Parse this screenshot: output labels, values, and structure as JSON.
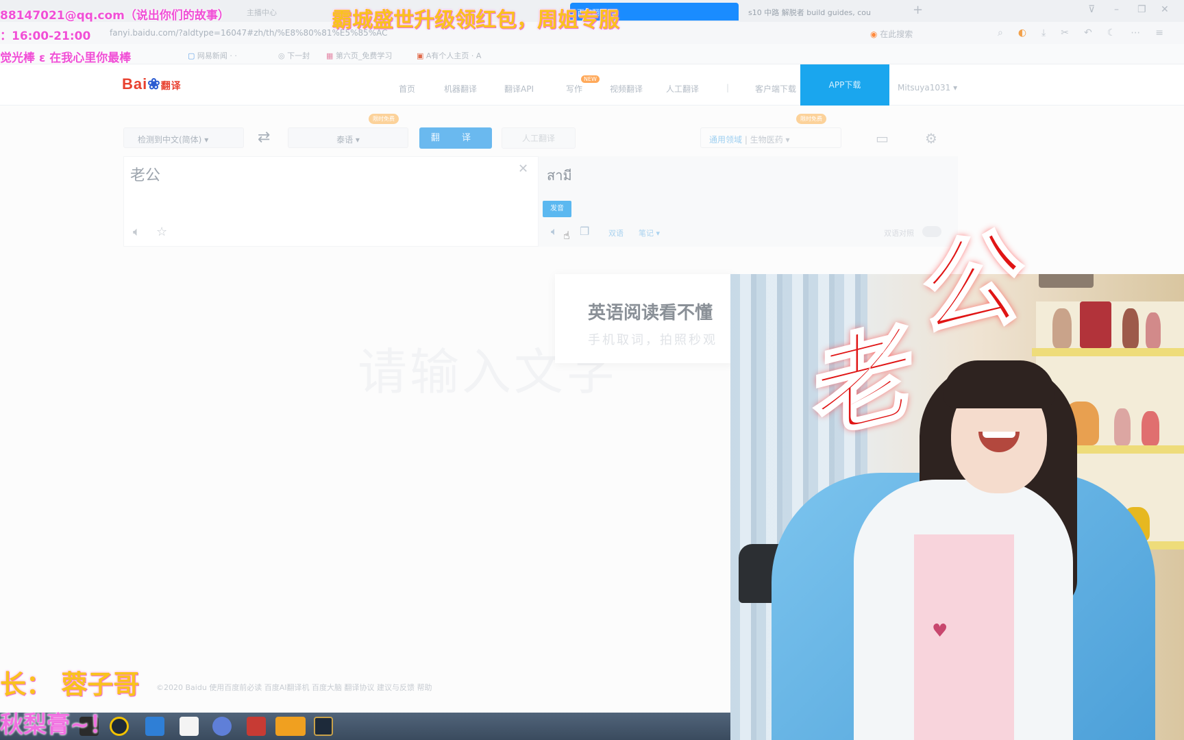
{
  "browser": {
    "tabs": [
      {
        "label": "主播中心",
        "active": false
      },
      {
        "label": "百度翻译",
        "active": true
      },
      {
        "label": "s10 中路 解脱者 build guides, cou",
        "active": false
      }
    ],
    "url": "fanyi.baidu.com/?aldtype=16047#zh/th/%E8%80%81%E5%85%AC",
    "address_search": "在此搜索",
    "bookmarks": [
      "网易新闻 · ·",
      "下一封",
      "第六页_免费学习",
      "A有个人主页 · A"
    ]
  },
  "site": {
    "logo": "Bai",
    "logo_sub": "翻译",
    "nav": [
      "首页",
      "机器翻译",
      "翻译API",
      "写作",
      "视频翻译",
      "人工翻译",
      "客户端下载"
    ],
    "nav_hot": "NEW",
    "app_button": "APP下载",
    "user": "Mitsuya1031"
  },
  "translator": {
    "source_lang": "检测到中文(简体)",
    "target_lang": "泰语",
    "translate_button": "翻  译",
    "human_button": "人工翻译",
    "promo_tag_left": "限时免费",
    "promo_tag_right": "限时免费",
    "domain_label": "通用领域",
    "domain_value": "生物医药",
    "source_text": "老公",
    "target_text": "สามี",
    "tooltip": "发音",
    "link_1": "双语",
    "link_2": "笔记",
    "toggle_label": "双语对照",
    "placeholder": "请输入文字",
    "promo_title": "英语阅读看不懂",
    "promo_sub": "手机取词，拍照秒观",
    "footer": "©2020 Baidu  使用百度前必读  百度AI翻译机  百度大脑  翻译协议  建议与反馈  帮助"
  },
  "overlays": {
    "email": "88147021@qq.com（说出你们的故事）",
    "time": "：16:00-21:00",
    "banner": "霸城盛世升级领红包，周姐专服",
    "line_left": "觉光棒 ε 在我心里你最棒",
    "bottom_label": "长：  蓉子哥",
    "bottom_line": "秋梨膏~！",
    "sticker": "老公"
  },
  "colors": {
    "app_button_bg": "#1aa6ee",
    "translate_btn_bg": "#6ab9ef",
    "overlay_pink": "#f04fd6",
    "overlay_yellow": "#f9c21e",
    "sticker_red": "#e01515"
  }
}
